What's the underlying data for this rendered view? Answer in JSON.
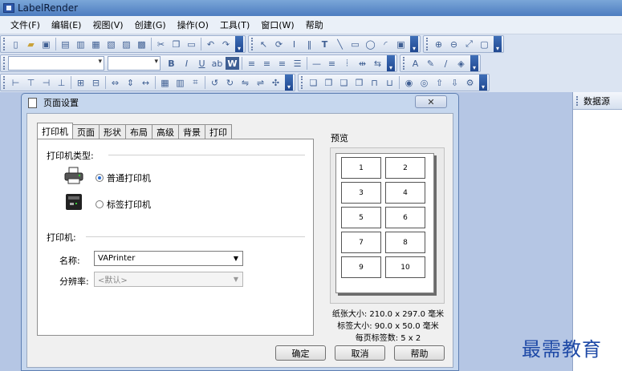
{
  "app": {
    "title": "LabelRender"
  },
  "menu": [
    "文件(F)",
    "编辑(E)",
    "视图(V)",
    "创建(G)",
    "操作(O)",
    "工具(T)",
    "窗口(W)",
    "帮助"
  ],
  "side_panel": {
    "title": "数据源"
  },
  "toolbar": {
    "format": {
      "bold": "B",
      "italic": "I",
      "underline": "U"
    },
    "draw": {
      "text": "T"
    }
  },
  "dialog": {
    "title": "页面设置",
    "close": "✕",
    "tabs": [
      "打印机",
      "页面",
      "形状",
      "布局",
      "高级",
      "背景",
      "打印"
    ],
    "printer_type_label": "打印机类型:",
    "radio_normal": "普通打印机",
    "radio_label": "标签打印机",
    "printer_group_label": "打印机:",
    "name_label": "名称:",
    "name_value": "VAPrinter",
    "resolution_label": "分辨率:",
    "resolution_value": "<默认>",
    "preview_label": "预览",
    "labels": [
      "1",
      "2",
      "3",
      "4",
      "5",
      "6",
      "7",
      "8",
      "9",
      "10"
    ],
    "paper_size": "纸张大小: 210.0 x 297.0 毫米",
    "label_size": "标签大小: 90.0 x 50.0 毫米",
    "labels_per_page": "每页标签数: 5 x 2",
    "ok": "确定",
    "cancel": "取消",
    "help": "帮助"
  },
  "watermark": "最需教育"
}
